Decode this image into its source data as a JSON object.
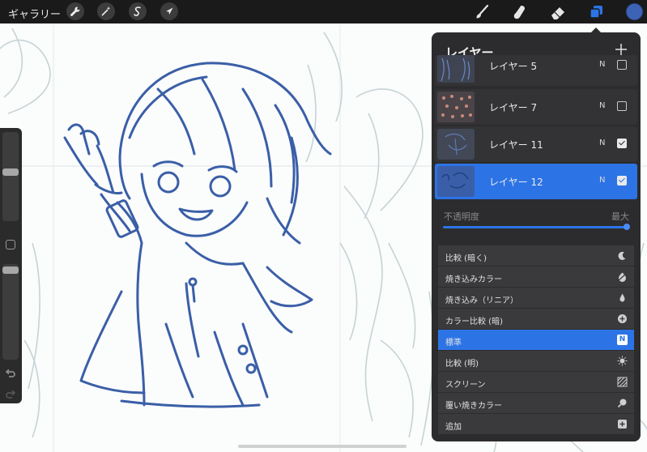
{
  "topbar": {
    "gallery_label": "ギャラリー",
    "left_tools": [
      "wrench-icon",
      "magic-wand-icon",
      "selection-icon",
      "transform-arrow-icon"
    ],
    "right_tools": [
      "brush-icon",
      "smudge-icon",
      "eraser-icon",
      "layers-icon"
    ],
    "current_color": "#3d64b4",
    "active_tool_color": "#2c74e6"
  },
  "layers_panel": {
    "title": "レイヤー",
    "add_icon": "plus-icon",
    "layers": [
      {
        "name": "レイヤー 5",
        "mode": "N",
        "visible": false,
        "selected": false
      },
      {
        "name": "レイヤー 7",
        "mode": "N",
        "visible": false,
        "selected": false
      },
      {
        "name": "レイヤー 11",
        "mode": "N",
        "visible": true,
        "selected": false
      },
      {
        "name": "レイヤー 12",
        "mode": "N",
        "visible": true,
        "selected": true
      }
    ],
    "opacity": {
      "label": "不透明度",
      "value_label": "最大",
      "value": 1.0
    },
    "blend_modes": [
      {
        "label": "比較 (暗く)",
        "icon": "moon-icon",
        "selected": false
      },
      {
        "label": "焼き込みカラー",
        "icon": "burn-icon",
        "selected": false
      },
      {
        "label": "焼き込み（リニア）",
        "icon": "flame-icon",
        "selected": false
      },
      {
        "label": "カラー比較 (暗)",
        "icon": "plus-circle-icon",
        "selected": false
      },
      {
        "label": "標準",
        "icon": "n-badge-icon",
        "badge": "N",
        "selected": true
      },
      {
        "label": "比較 (明)",
        "icon": "sun-icon",
        "selected": false
      },
      {
        "label": "スクリーン",
        "icon": "hatch-icon",
        "selected": false
      },
      {
        "label": "覆い焼きカラー",
        "icon": "magnifier-icon",
        "selected": false
      },
      {
        "label": "追加",
        "icon": "plus-square-icon",
        "selected": false
      }
    ]
  },
  "sidebar": {
    "brush_size_level": 0.55,
    "opacity_level": 0.97,
    "icons": [
      "modify-square-icon",
      "undo-icon",
      "redo-icon"
    ]
  }
}
